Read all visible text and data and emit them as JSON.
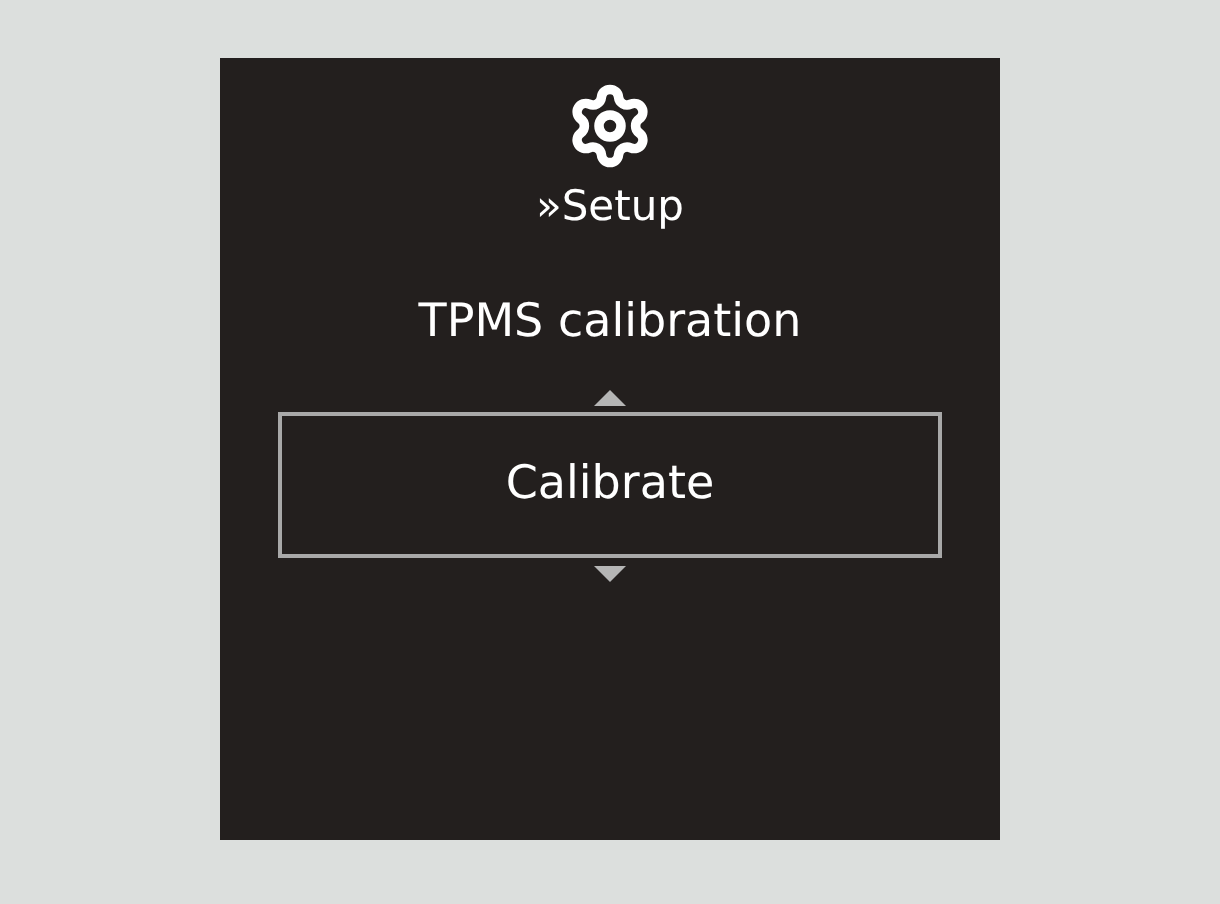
{
  "menu": {
    "section": "»Setup",
    "title": "TPMS calibration",
    "option": "Calibrate"
  }
}
